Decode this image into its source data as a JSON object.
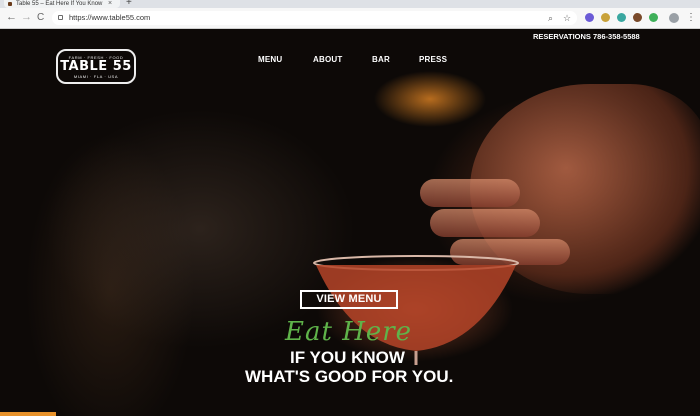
{
  "browser": {
    "tab_title": "Table 55 – Eat Here If You Know",
    "tab_close": "×",
    "new_tab": "+",
    "back": "←",
    "forward": "→",
    "reload": "C",
    "url": "https://www.table55.com",
    "menu": "⋮"
  },
  "site": {
    "logo": {
      "top": "FARM · FRESH · FOOD",
      "main": "TABLE 55",
      "bottom": "MIAMI · FLA · USA"
    },
    "nav": [
      "MENU",
      "ABOUT",
      "BAR",
      "PRESS"
    ],
    "reservations": "RESERVATIONS  786-358-5588"
  },
  "hero": {
    "cta": "VIEW MENU",
    "script_title": "Eat Here",
    "tagline_line1": "IF YOU KNOW",
    "tagline_line2": "WHAT'S GOOD FOR YOU."
  },
  "colors": {
    "accent_green": "#5fb34a",
    "accent_orange": "#e8922a"
  }
}
